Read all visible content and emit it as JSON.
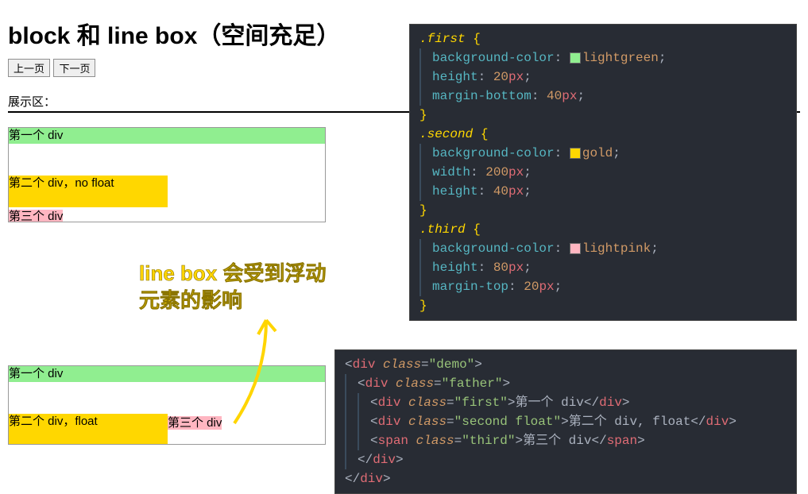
{
  "header": {
    "title": "block 和 line box（空间充足）",
    "prev_label": "上一页",
    "next_label": "下一页",
    "section_label": "展示区："
  },
  "demo1": {
    "first": "第一个 div",
    "second": "第二个 div，no float",
    "third": "第三个 div"
  },
  "demo2": {
    "first": "第一个 div",
    "second": "第二个 div，float",
    "third": "第三个 div"
  },
  "annotation": {
    "line1": "line box 会受到浮动",
    "line2": "元素的影响"
  },
  "css_code": {
    "rules": [
      {
        "selector": ".first",
        "decls": [
          {
            "prop": "background-color",
            "value": "lightgreen",
            "swatch": "#90ee90"
          },
          {
            "prop": "height",
            "num": "20",
            "unit": "px"
          },
          {
            "prop": "margin-bottom",
            "num": "40",
            "unit": "px"
          }
        ]
      },
      {
        "selector": ".second",
        "decls": [
          {
            "prop": "background-color",
            "value": "gold",
            "swatch": "#ffd700"
          },
          {
            "prop": "width",
            "num": "200",
            "unit": "px"
          },
          {
            "prop": "height",
            "num": "40",
            "unit": "px"
          }
        ]
      },
      {
        "selector": ".third",
        "decls": [
          {
            "prop": "background-color",
            "value": "lightpink",
            "swatch": "#ffb6c1"
          },
          {
            "prop": "height",
            "num": "80",
            "unit": "px"
          },
          {
            "prop": "margin-top",
            "num": "20",
            "unit": "px"
          }
        ]
      }
    ]
  },
  "html_code": {
    "lines": [
      {
        "indent": 0,
        "open": "div",
        "attr": "class",
        "val": "demo"
      },
      {
        "indent": 1,
        "open": "div",
        "attr": "class",
        "val": "father"
      },
      {
        "indent": 2,
        "open": "div",
        "attr": "class",
        "val": "first",
        "text": "第一个 div",
        "close": "div"
      },
      {
        "indent": 2,
        "open": "div",
        "attr": "class",
        "val": "second float",
        "text": "第二个 div, float",
        "close": "div"
      },
      {
        "indent": 2,
        "open": "span",
        "attr": "class",
        "val": "third",
        "text": "第三个 div",
        "close": "span"
      },
      {
        "indent": 1,
        "closeonly": "div"
      },
      {
        "indent": 0,
        "closeonly": "div"
      }
    ]
  }
}
